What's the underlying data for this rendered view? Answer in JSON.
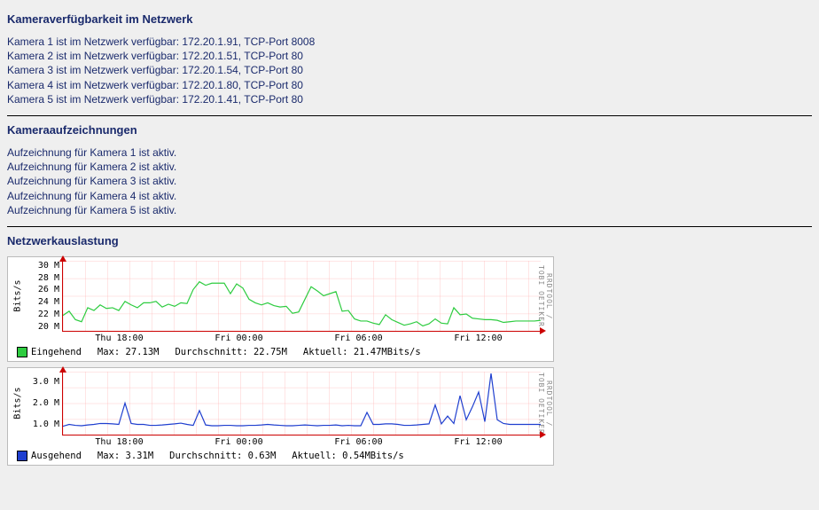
{
  "sections": {
    "availability": {
      "title": "Kameraverfügbarkeit im Netzwerk",
      "lines": [
        "Kamera 1 ist im Netzwerk verfügbar: 172.20.1.91, TCP-Port 8008",
        "Kamera 2 ist im Netzwerk verfügbar: 172.20.1.51, TCP-Port 80",
        "Kamera 3 ist im Netzwerk verfügbar: 172.20.1.54, TCP-Port 80",
        "Kamera 4 ist im Netzwerk verfügbar: 172.20.1.80, TCP-Port 80",
        "Kamera 5 ist im Netzwerk verfügbar: 172.20.1.41, TCP-Port 80"
      ]
    },
    "recordings": {
      "title": "Kameraaufzeichnungen",
      "lines": [
        "Aufzeichnung für Kamera 1 ist aktiv.",
        "Aufzeichnung für Kamera 2 ist aktiv.",
        "Aufzeichnung für Kamera 3 ist aktiv.",
        "Aufzeichnung für Kamera 4 ist aktiv.",
        "Aufzeichnung für Kamera 5 ist aktiv."
      ]
    },
    "network": {
      "title": "Netzwerkauslastung"
    }
  },
  "watermark": "RRDTOOL / TOBI OETIKER",
  "chart_data": [
    {
      "type": "line",
      "name": "Eingehend",
      "color": "#2ecc40",
      "ylabel": "Bits/s",
      "x_ticks": [
        "Thu 18:00",
        "Fri 00:00",
        "Fri 06:00",
        "Fri 12:00"
      ],
      "y_ticks": [
        "30 M",
        "28 M",
        "26 M",
        "24 M",
        "22 M",
        "20 M"
      ],
      "ylim": [
        20,
        30
      ],
      "values": [
        22.2,
        22.8,
        21.6,
        21.3,
        23.3,
        22.9,
        23.7,
        23.2,
        23.3,
        22.9,
        24.2,
        23.7,
        23.3,
        24.0,
        24.0,
        24.2,
        23.4,
        23.8,
        23.5,
        24.0,
        23.9,
        25.9,
        27.0,
        26.5,
        26.8,
        26.8,
        26.8,
        25.3,
        26.7,
        26.1,
        24.5,
        24.0,
        23.7,
        24.0,
        23.6,
        23.4,
        23.5,
        22.5,
        22.7,
        24.5,
        26.3,
        25.7,
        25.0,
        25.3,
        25.6,
        22.8,
        22.9,
        21.7,
        21.4,
        21.4,
        21.1,
        20.9,
        22.3,
        21.6,
        21.2,
        20.8,
        21.0,
        21.3,
        20.7,
        21.0,
        21.7,
        21.1,
        21.0,
        23.3,
        22.3,
        22.4,
        21.8,
        21.7,
        21.6,
        21.6,
        21.5,
        21.2,
        21.3,
        21.4,
        21.4,
        21.4,
        21.4,
        21.5
      ],
      "stats": {
        "max_label": "Max:",
        "max": "27.13M",
        "avg_label": "Durchschnitt:",
        "avg": "22.75M",
        "cur_label": "Aktuell:",
        "cur": "21.47MBits/s"
      }
    },
    {
      "type": "line",
      "name": "Ausgehend",
      "color": "#1f3fcf",
      "ylabel": "Bits/s",
      "x_ticks": [
        "Thu 18:00",
        "Fri 00:00",
        "Fri 06:00",
        "Fri 12:00"
      ],
      "y_ticks": [
        "3.0 M",
        "2.0 M",
        "1.0 M"
      ],
      "ylim": [
        0,
        3.4
      ],
      "values": [
        0.45,
        0.55,
        0.5,
        0.48,
        0.52,
        0.55,
        0.6,
        0.6,
        0.58,
        0.55,
        1.7,
        0.6,
        0.55,
        0.55,
        0.5,
        0.5,
        0.52,
        0.55,
        0.58,
        0.62,
        0.55,
        0.5,
        1.3,
        0.52,
        0.48,
        0.48,
        0.5,
        0.5,
        0.48,
        0.48,
        0.5,
        0.5,
        0.52,
        0.55,
        0.52,
        0.5,
        0.48,
        0.48,
        0.5,
        0.52,
        0.5,
        0.48,
        0.5,
        0.5,
        0.52,
        0.48,
        0.5,
        0.48,
        0.48,
        1.2,
        0.55,
        0.55,
        0.58,
        0.58,
        0.55,
        0.5,
        0.5,
        0.52,
        0.55,
        0.58,
        1.6,
        0.58,
        1.0,
        0.6,
        2.1,
        0.8,
        1.5,
        2.3,
        0.7,
        3.3,
        0.8,
        0.6,
        0.55,
        0.55,
        0.55,
        0.55,
        0.55,
        0.55
      ],
      "stats": {
        "max_label": "Max:",
        "max": "3.31M",
        "avg_label": "Durchschnitt:",
        "avg": "0.63M",
        "cur_label": "Aktuell:",
        "cur": "0.54MBits/s"
      }
    }
  ]
}
